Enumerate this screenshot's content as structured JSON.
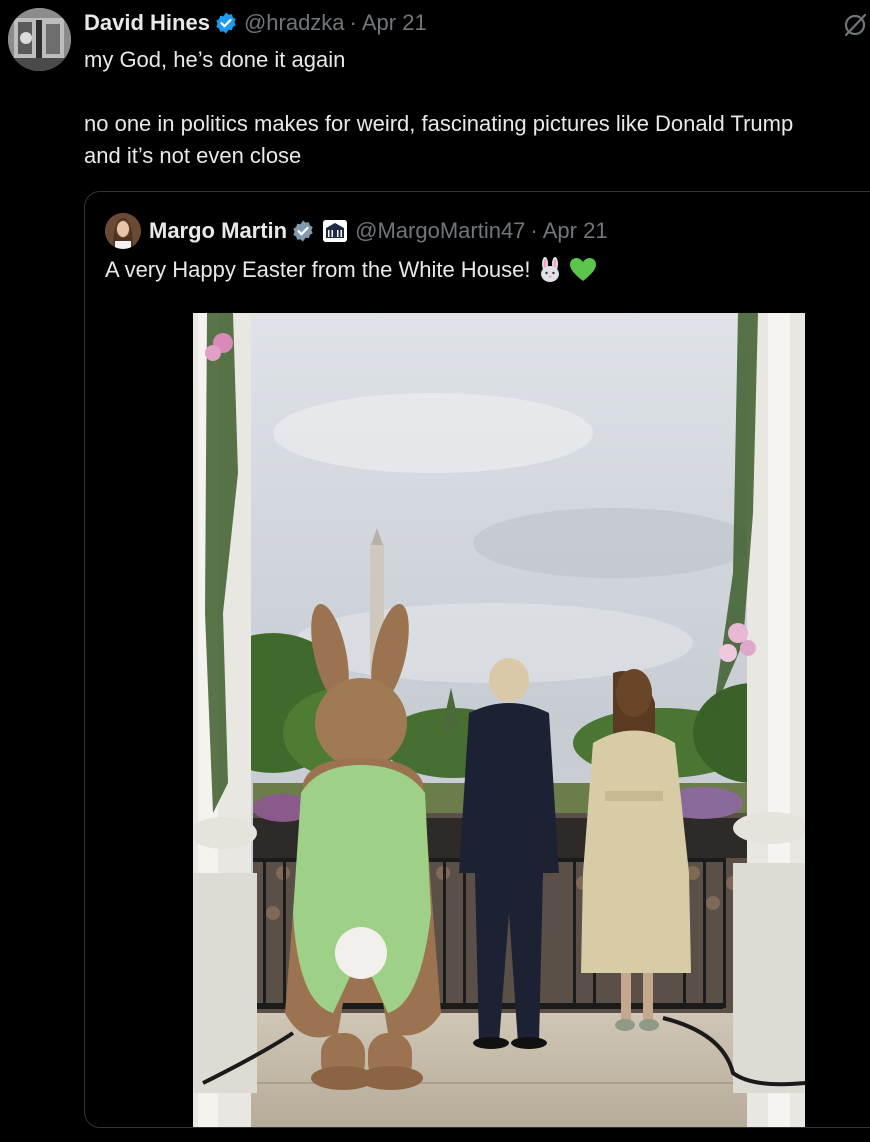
{
  "tweet": {
    "author_name": "David Hines",
    "handle": "@hradzka",
    "separator": "·",
    "date": "Apr 21",
    "text_lines": [
      "my God, he’s done it again",
      "",
      "no one in politics makes for weird, fascinating pictures like Donald Trump",
      "and it’s not even close"
    ]
  },
  "quote": {
    "author_name": "Margo Martin",
    "handle": "@MargoMartin47",
    "separator": "·",
    "date": "Apr 21",
    "text": "A very Happy Easter from the White House!",
    "emojis": [
      "rabbit-face-emoji",
      "green-heart-emoji"
    ]
  },
  "colors": {
    "background": "#000000",
    "text": "#e7e9ea",
    "secondary_text": "#71767b",
    "verified_blue": "#1d9bf0",
    "border": "#2f3336"
  }
}
